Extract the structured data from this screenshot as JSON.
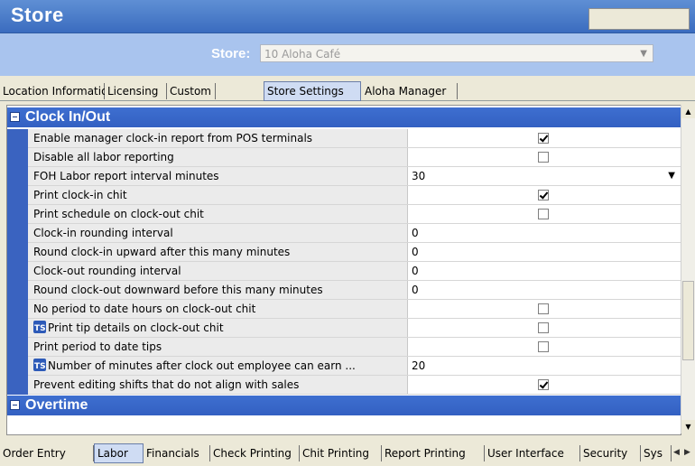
{
  "window": {
    "title": "Store"
  },
  "store_selector": {
    "label": "Store:",
    "value": "10 Aloha Café"
  },
  "top_tabs": [
    {
      "label": "Location Information",
      "active": false
    },
    {
      "label": "Licensing",
      "active": false
    },
    {
      "label": "Custom",
      "active": false
    },
    {
      "label": "Store Settings",
      "active": true
    },
    {
      "label": "Aloha Manager",
      "active": false
    }
  ],
  "sections": {
    "clock": "Clock In/Out",
    "overtime": "Overtime"
  },
  "rows": [
    {
      "label": "Enable manager clock-in report from POS terminals",
      "type": "checkbox",
      "checked": true
    },
    {
      "label": "Disable all labor reporting",
      "type": "checkbox",
      "checked": false
    },
    {
      "label": "FOH Labor report interval minutes",
      "type": "dropdown",
      "value": "30"
    },
    {
      "label": "Print clock-in chit",
      "type": "checkbox",
      "checked": true
    },
    {
      "label": "Print schedule on clock-out chit",
      "type": "checkbox",
      "checked": false
    },
    {
      "label": "Clock-in rounding interval",
      "type": "text",
      "value": "0"
    },
    {
      "label": "Round clock-in upward after this many minutes",
      "type": "text",
      "value": "0"
    },
    {
      "label": "Clock-out rounding interval",
      "type": "text",
      "value": "0"
    },
    {
      "label": "Round clock-out downward before this many minutes",
      "type": "text",
      "value": "0"
    },
    {
      "label": "No period to date hours on clock-out chit",
      "type": "checkbox",
      "checked": false
    },
    {
      "label": "Print tip details on clock-out chit",
      "type": "checkbox",
      "checked": false,
      "icon": "ts-icon"
    },
    {
      "label": "Print period to date tips",
      "type": "checkbox",
      "checked": false
    },
    {
      "label": "Number of minutes after clock out employee can earn ...",
      "type": "text",
      "value": "20",
      "icon": "ts-icon"
    },
    {
      "label": "Prevent editing shifts that do not align with sales",
      "type": "checkbox",
      "checked": true
    }
  ],
  "bottom_tabs": [
    {
      "label": "Order Entry",
      "active": false
    },
    {
      "label": "Labor",
      "active": true
    },
    {
      "label": "Financials",
      "active": false
    },
    {
      "label": "Check Printing",
      "active": false
    },
    {
      "label": "Chit Printing",
      "active": false
    },
    {
      "label": "Report Printing",
      "active": false
    },
    {
      "label": "User Interface",
      "active": false
    },
    {
      "label": "Security",
      "active": false
    },
    {
      "label": "Sys",
      "active": false
    }
  ],
  "colors": {
    "section_header": "#3360c2",
    "title_bar": "#3b6cbf",
    "store_bar": "#a9c4ee"
  }
}
